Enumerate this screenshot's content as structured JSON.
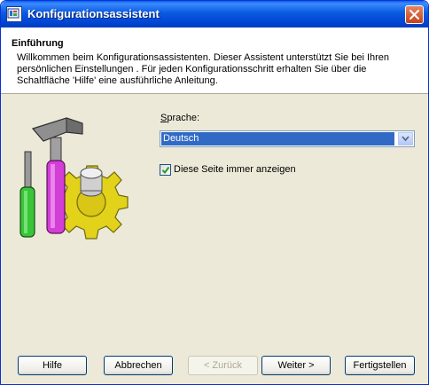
{
  "window": {
    "title": "Konfigurationsassistent",
    "app_icon": "wizard-app-icon",
    "close_icon": "close-icon",
    "accent_color": "#0054e3"
  },
  "header": {
    "title": "Einführung",
    "description": "Willkommen beim Konfigurationsassistenten. Dieser Assistent unterstützt Sie bei  Ihren persönlichen Einstellungen . Für jeden Konfigurationsschritt erhalten Sie über die Schaltfläche 'Hilfe' eine ausführliche Anleitung."
  },
  "image": {
    "icon": "tools-gear-icon"
  },
  "language": {
    "label_accel": "S",
    "label_rest": "prache:",
    "selected": "Deutsch"
  },
  "checkbox": {
    "label": "Diese Seite immer anzeigen",
    "checked": true
  },
  "buttons": {
    "help": "Hilfe",
    "cancel": "Abbrechen",
    "back": "< Zurück",
    "next": "Weiter >",
    "finish": "Fertigstellen"
  }
}
